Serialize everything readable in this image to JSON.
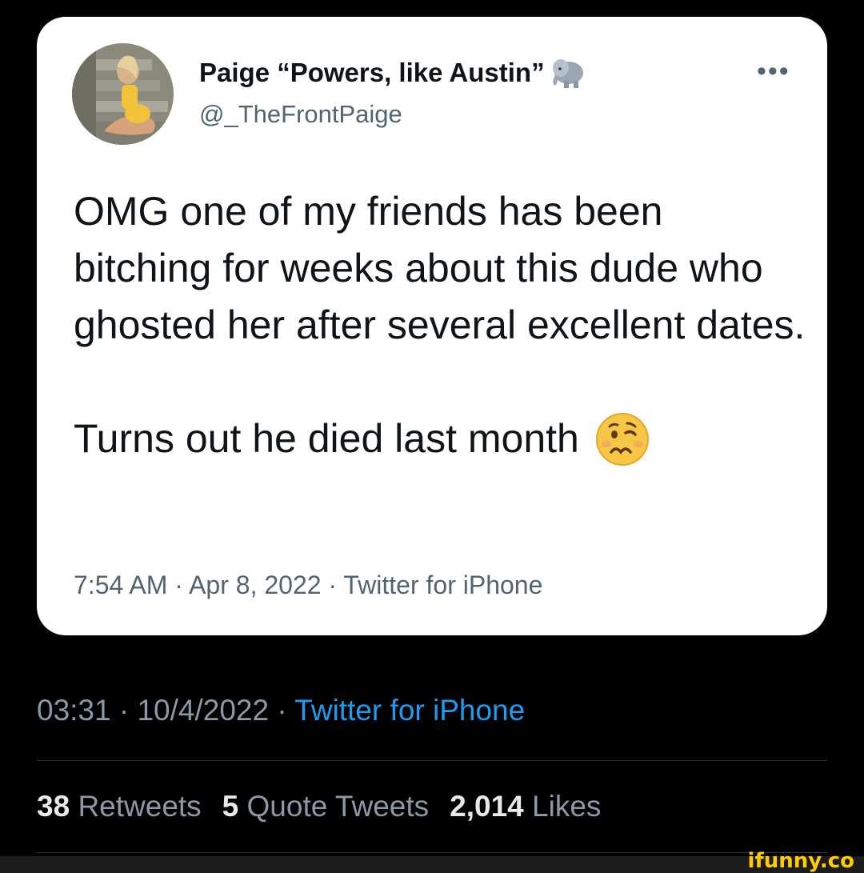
{
  "tweet": {
    "author_name": "Paige “Powers, like Austin”",
    "author_handle": "@_TheFrontPaige",
    "more_label": "•••",
    "text_line1": "OMG one of my friends has been bitching for weeks about this dude who ghosted her after several excellent dates.",
    "text_line2": "Turns out he died last month",
    "meta": "7:54 AM · Apr 8, 2022 · Twitter for iPhone"
  },
  "outer": {
    "time_date": "03:31 · 10/4/2022 · ",
    "source": "Twitter for iPhone",
    "stats": [
      {
        "count": "38",
        "label": "Retweets"
      },
      {
        "count": "5",
        "label": "Quote Tweets"
      },
      {
        "count": "2,014",
        "label": "Likes"
      }
    ]
  },
  "watermark": "ifunny.co",
  "icons": {
    "emoji": "woozy-face-icon",
    "name_emoji": "elephant-icon",
    "more": "more-icon"
  }
}
